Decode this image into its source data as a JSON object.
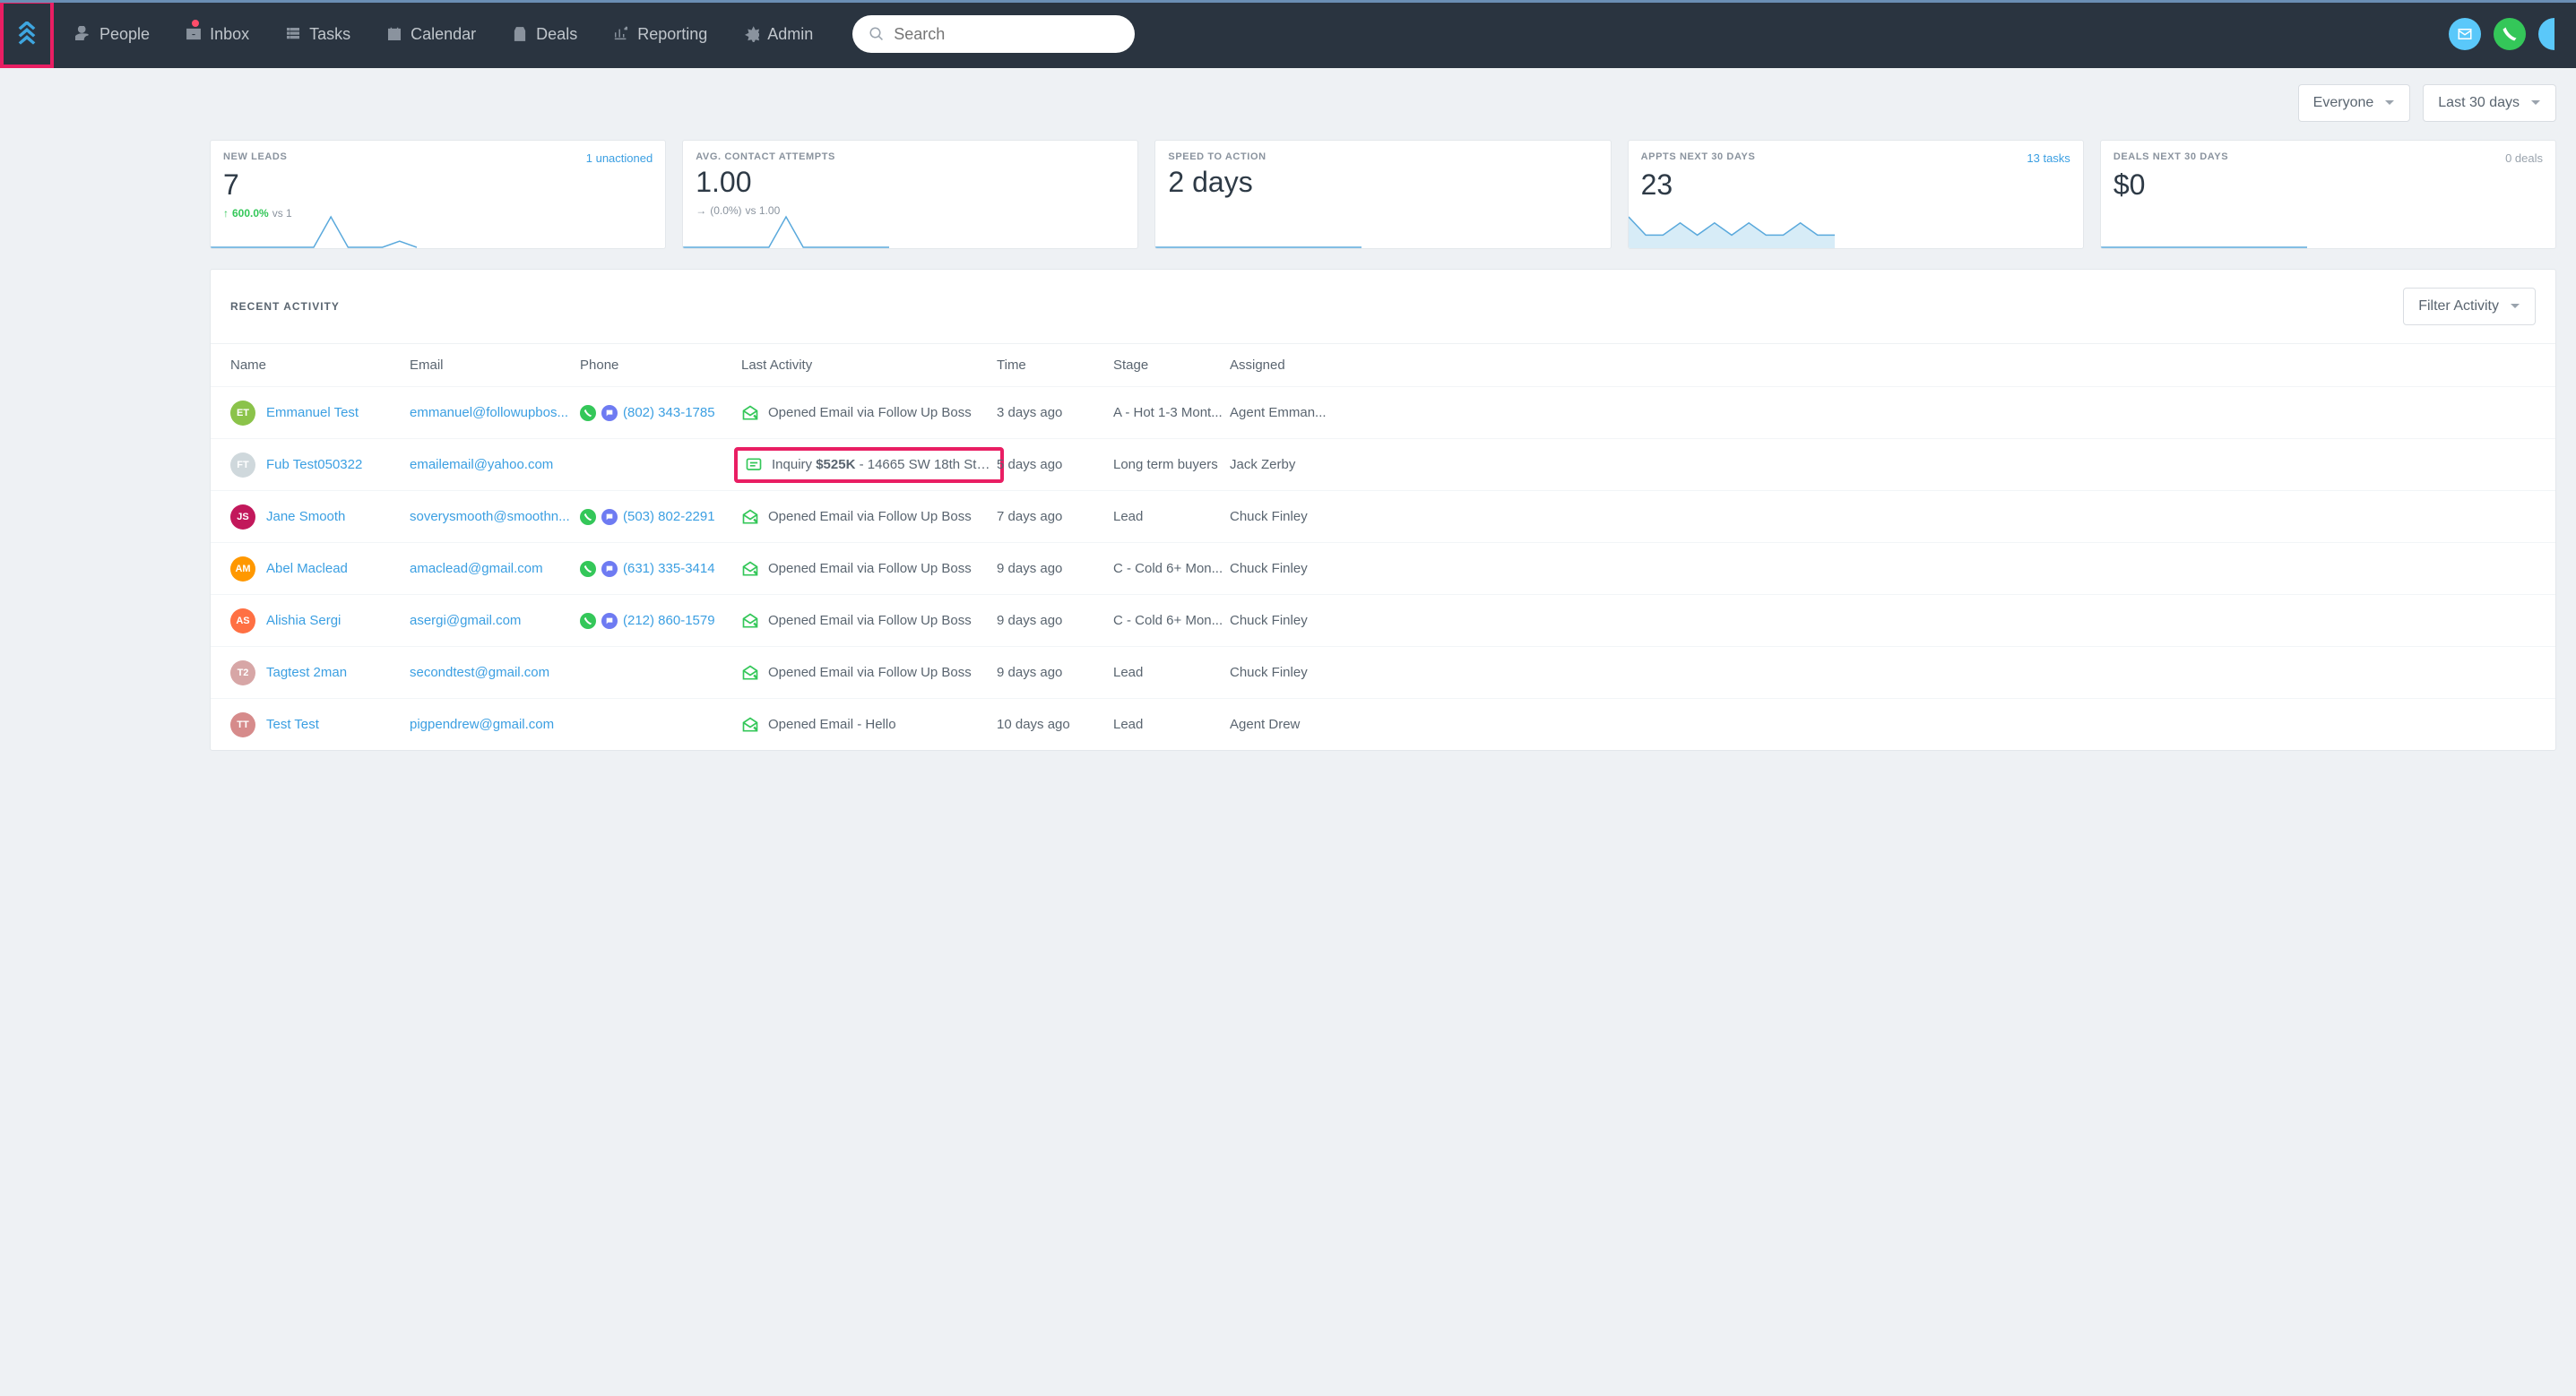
{
  "nav": {
    "items": [
      {
        "id": "people",
        "label": "People"
      },
      {
        "id": "inbox",
        "label": "Inbox"
      },
      {
        "id": "tasks",
        "label": "Tasks"
      },
      {
        "id": "calendar",
        "label": "Calendar"
      },
      {
        "id": "deals",
        "label": "Deals"
      },
      {
        "id": "reporting",
        "label": "Reporting"
      },
      {
        "id": "admin",
        "label": "Admin"
      }
    ],
    "search_placeholder": "Search"
  },
  "filters": {
    "scope": "Everyone",
    "range": "Last 30 days"
  },
  "cards": [
    {
      "label": "NEW LEADS",
      "sub": "1 unactioned",
      "sub_link": true,
      "value": "7",
      "delta_dir": "up",
      "delta_pct": "600.0%",
      "delta_vs": "vs 1"
    },
    {
      "label": "AVG. CONTACT ATTEMPTS",
      "sub": "",
      "value": "1.00",
      "delta_dir": "flat",
      "delta_pct": "(0.0%)",
      "delta_vs": "vs 1.00"
    },
    {
      "label": "SPEED TO ACTION",
      "sub": "",
      "value": "2 days",
      "delta_dir": "",
      "delta_pct": "",
      "delta_vs": ""
    },
    {
      "label": "APPTS NEXT 30 DAYS",
      "sub": "13 tasks",
      "sub_link": true,
      "value": "23",
      "delta_dir": "",
      "delta_pct": "",
      "delta_vs": ""
    },
    {
      "label": "DEALS NEXT 30 DAYS",
      "sub": "0 deals",
      "sub_link": false,
      "value": "$0",
      "delta_dir": "",
      "delta_pct": "",
      "delta_vs": ""
    }
  ],
  "activity": {
    "title": "RECENT ACTIVITY",
    "filter_btn": "Filter Activity",
    "cols": {
      "name": "Name",
      "email": "Email",
      "phone": "Phone",
      "last": "Last Activity",
      "time": "Time",
      "stage": "Stage",
      "assigned": "Assigned"
    },
    "rows": [
      {
        "av": "ET",
        "avc": "c-et",
        "name": "Emmanuel Test",
        "email": "emmanuel@followupbos...",
        "phone": "(802) 343-1785",
        "has_phone_badges": true,
        "act_icon": "open",
        "act_html": "Opened Email via Follow Up Boss",
        "time": "3 days ago",
        "stage": "A - Hot 1-3 Mont...",
        "assigned": "Agent Emman...",
        "hl": false
      },
      {
        "av": "FT",
        "avc": "c-ft",
        "name": "Fub Test050322",
        "email": "emailemail@yahoo.com",
        "phone": "",
        "has_phone_badges": false,
        "act_icon": "inquiry",
        "act_html": "Inquiry <b>$525K</b> - 14665 SW 18th St 3...",
        "time": "5 days ago",
        "stage": "Long term buyers",
        "assigned": "Jack Zerby",
        "hl": true
      },
      {
        "av": "JS",
        "avc": "c-js",
        "name": "Jane Smooth",
        "email": "soverysmooth@smoothn...",
        "phone": "(503) 802-2291",
        "has_phone_badges": true,
        "act_icon": "open",
        "act_html": "Opened Email via Follow Up Boss",
        "time": "7 days ago",
        "stage": "Lead",
        "assigned": "Chuck Finley",
        "hl": false
      },
      {
        "av": "AM",
        "avc": "c-am",
        "name": "Abel Maclead",
        "email": "amaclead@gmail.com",
        "phone": "(631) 335-3414",
        "has_phone_badges": true,
        "act_icon": "open",
        "act_html": "Opened Email via Follow Up Boss",
        "time": "9 days ago",
        "stage": "C - Cold 6+ Mon...",
        "assigned": "Chuck Finley",
        "hl": false
      },
      {
        "av": "AS",
        "avc": "c-as",
        "name": "Alishia Sergi",
        "email": "asergi@gmail.com",
        "phone": "(212) 860-1579",
        "has_phone_badges": true,
        "act_icon": "open",
        "act_html": "Opened Email via Follow Up Boss",
        "time": "9 days ago",
        "stage": "C - Cold 6+ Mon...",
        "assigned": "Chuck Finley",
        "hl": false
      },
      {
        "av": "T2",
        "avc": "c-t2",
        "name": "Tagtest 2man",
        "email": "secondtest@gmail.com",
        "phone": "",
        "has_phone_badges": false,
        "act_icon": "open",
        "act_html": "Opened Email via Follow Up Boss",
        "time": "9 days ago",
        "stage": "Lead",
        "assigned": "Chuck Finley",
        "hl": false
      },
      {
        "av": "TT",
        "avc": "c-tt",
        "name": "Test Test",
        "email": "pigpendrew@gmail.com",
        "phone": "",
        "has_phone_badges": false,
        "act_icon": "open",
        "act_html": "Opened Email - Hello",
        "time": "10 days ago",
        "stage": "Lead",
        "assigned": "Agent Drew",
        "hl": false
      }
    ]
  },
  "chart_data": [
    {
      "type": "line",
      "title": "NEW LEADS",
      "values": [
        0,
        0,
        0,
        0,
        0,
        0,
        0,
        5,
        0,
        0,
        0,
        1,
        0
      ]
    },
    {
      "type": "line",
      "title": "AVG. CONTACT ATTEMPTS",
      "values": [
        0,
        0,
        0,
        0,
        0,
        0,
        5,
        0,
        0,
        0,
        0,
        0,
        0
      ]
    },
    {
      "type": "line",
      "title": "SPEED TO ACTION",
      "values": [
        0,
        0,
        0,
        0,
        0,
        0,
        0,
        0,
        0,
        0,
        0,
        0,
        0
      ]
    },
    {
      "type": "area",
      "title": "APPTS NEXT 30 DAYS",
      "values": [
        5,
        2,
        2,
        4,
        2,
        4,
        2,
        4,
        2,
        2,
        4,
        2,
        2
      ]
    },
    {
      "type": "line",
      "title": "DEALS NEXT 30 DAYS",
      "values": [
        0,
        0,
        0,
        0,
        0,
        0,
        0,
        0,
        0,
        0,
        0,
        0,
        0
      ]
    }
  ]
}
